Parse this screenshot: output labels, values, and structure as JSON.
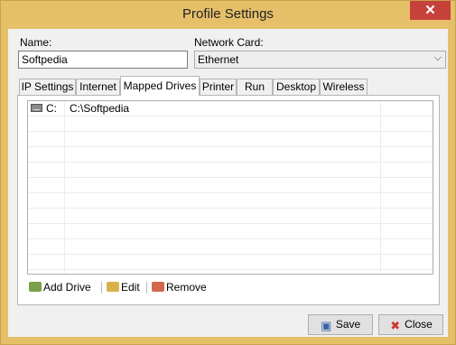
{
  "window": {
    "title": "Profile Settings",
    "close_glyph": "✕"
  },
  "form": {
    "name_label": "Name:",
    "name_value": "Softpedia",
    "network_card_label": "Network Card:",
    "network_card_value": "Ethernet"
  },
  "tabs": [
    {
      "label": "IP Settings"
    },
    {
      "label": "Internet"
    },
    {
      "label": "Mapped Drives",
      "active": true
    },
    {
      "label": "Printer"
    },
    {
      "label": "Run"
    },
    {
      "label": "Desktop"
    },
    {
      "label": "Wireless"
    }
  ],
  "drives": [
    {
      "letter": "C:",
      "path": "C:\\Softpedia",
      "icon": "drive-icon"
    }
  ],
  "toolbar": {
    "add_label": "Add Drive",
    "edit_label": "Edit",
    "remove_label": "Remove"
  },
  "footer": {
    "save_label": "Save",
    "close_label": "Close"
  },
  "colors": {
    "title_bar": "#e6c069",
    "close_button": "#c7413b",
    "window_bg": "#f0f0f0"
  }
}
